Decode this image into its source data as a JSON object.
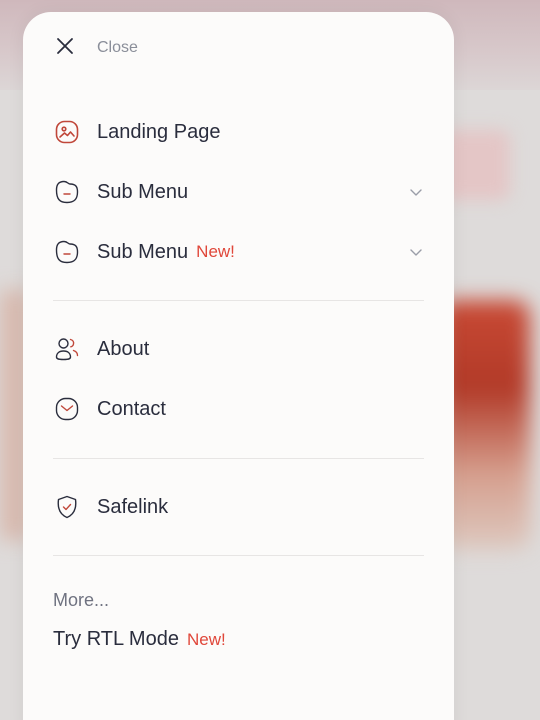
{
  "drawer": {
    "close_label": "Close",
    "items": [
      {
        "label": "Landing Page",
        "icon": "image-icon"
      },
      {
        "label": "Sub Menu",
        "icon": "folder-icon",
        "has_submenu": true
      },
      {
        "label": "Sub Menu",
        "icon": "folder-icon",
        "badge": "New!",
        "has_submenu": true
      },
      {
        "label": "About",
        "icon": "users-icon"
      },
      {
        "label": "Contact",
        "icon": "mail-icon"
      },
      {
        "label": "Safelink",
        "icon": "shield-check-icon"
      }
    ],
    "more_label": "More...",
    "rtl": {
      "label": "Try RTL Mode",
      "badge": "New!"
    }
  },
  "colors": {
    "text": "#2a2d3d",
    "muted": "#8a8e99",
    "accent": "#e0473a",
    "drawer_bg": "#fcfbfa"
  }
}
